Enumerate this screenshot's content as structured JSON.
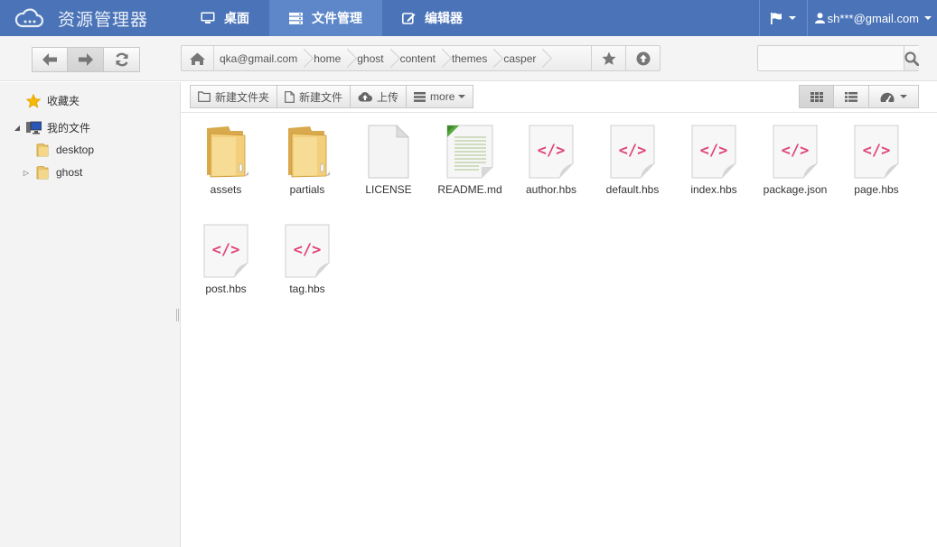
{
  "app": {
    "title": "资源管理器"
  },
  "nav": {
    "tabs": [
      {
        "label": "桌面",
        "icon": "monitor-icon"
      },
      {
        "label": "文件管理",
        "icon": "server-icon",
        "active": true
      },
      {
        "label": "编辑器",
        "icon": "edit-icon"
      }
    ],
    "flag_icon": "flag-icon",
    "user": "sh***@gmail.com"
  },
  "breadcrumb": [
    "qka@gmail.com",
    "home",
    "ghost",
    "content",
    "themes",
    "casper"
  ],
  "search": {
    "placeholder": ""
  },
  "sidebar": {
    "favorites": "收藏夹",
    "my_files": "我的文件",
    "children": [
      "desktop",
      "ghost"
    ]
  },
  "actions": {
    "new_folder": "新建文件夹",
    "new_file": "新建文件",
    "upload": "上传",
    "more": "more"
  },
  "files": [
    {
      "name": "assets",
      "type": "folder"
    },
    {
      "name": "partials",
      "type": "folder"
    },
    {
      "name": "LICENSE",
      "type": "blank"
    },
    {
      "name": "README.md",
      "type": "text"
    },
    {
      "name": "author.hbs",
      "type": "code"
    },
    {
      "name": "default.hbs",
      "type": "code"
    },
    {
      "name": "index.hbs",
      "type": "code"
    },
    {
      "name": "package.json",
      "type": "code"
    },
    {
      "name": "page.hbs",
      "type": "code"
    },
    {
      "name": "post.hbs",
      "type": "code"
    },
    {
      "name": "tag.hbs",
      "type": "code"
    }
  ],
  "colors": {
    "navbar": "#4b74b8",
    "active_tab": "#5d87c9",
    "code_icon": "#e0457b"
  }
}
